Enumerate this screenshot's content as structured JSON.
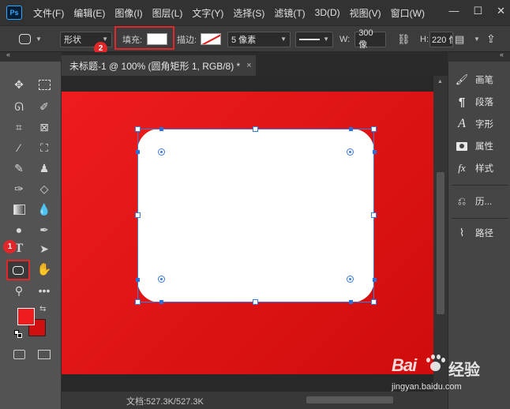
{
  "app": {
    "logo": "Ps"
  },
  "menu": [
    "文件(F)",
    "编辑(E)",
    "图像(I)",
    "图层(L)",
    "文字(Y)",
    "选择(S)",
    "滤镜(T)",
    "3D(D)",
    "视图(V)",
    "窗口(W)"
  ],
  "window_buttons": {
    "minimize": "—",
    "maximize": "☐",
    "close": "✕"
  },
  "options": {
    "mode": "形状",
    "fill_label": "填充:",
    "fill_color": "#ffffff",
    "stroke_label": "描边:",
    "stroke_size": "5 像素",
    "width_label": "W:",
    "width_value": "300 像",
    "height_label": "H:",
    "height_value": "220 像"
  },
  "document": {
    "tab_title": "未标题-1 @ 100% (圆角矩形 1, RGB/8) *",
    "close": "×",
    "canvas_color": "#e41616",
    "shape_fill": "#ffffff",
    "status_text": "文档:527.3K/527.3K"
  },
  "annotations": {
    "badge_1": "1",
    "badge_2": "2",
    "highlight_color": "#e1272a"
  },
  "colors": {
    "foreground": "#ee1c1c",
    "background": "#d01010",
    "accent": "#3b7bd9"
  },
  "panels": [
    {
      "label": "画笔",
      "icon": "brush-panel-icon"
    },
    {
      "label": "段落",
      "icon": "paragraph-icon"
    },
    {
      "label": "字形",
      "icon": "glyphs-icon"
    },
    {
      "label": "属性",
      "icon": "properties-icon"
    },
    {
      "label": "样式",
      "icon": "styles-icon"
    },
    {
      "label": "历...",
      "icon": "history-icon"
    },
    {
      "label": "路径",
      "icon": "paths-icon"
    }
  ],
  "watermark": {
    "brand": "Bai",
    "brand2": "经验",
    "url": "jingyan.baidu.com"
  }
}
